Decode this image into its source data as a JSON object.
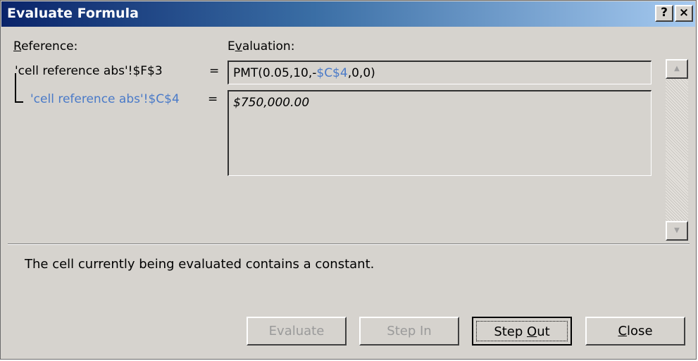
{
  "window": {
    "title": "Evaluate Formula",
    "help_label": "?",
    "close_label": "×"
  },
  "labels": {
    "reference_prefix": "R",
    "reference_rest": "eference:",
    "evaluation_prefix": "E",
    "evaluation_underline": "v",
    "evaluation_rest": "aluation:"
  },
  "references": {
    "main": "'cell reference abs'!$F$3",
    "main_eq": "=",
    "sub": "'cell reference abs'!$C$4",
    "sub_eq": "="
  },
  "evaluation": {
    "formula_before": "PMT(0.05,10,-",
    "formula_highlight": "$C$4",
    "formula_after": ",0,0)",
    "sub_value": "$750,000.00"
  },
  "scrollbar": {
    "up_icon": "▲",
    "down_icon": "▼"
  },
  "status": "The cell currently being evaluated contains a constant.",
  "buttons": {
    "evaluate": "Evaluate",
    "step_in": "Step In",
    "step_out_before": "Step ",
    "step_out_underline": "O",
    "step_out_after": "ut",
    "close_underline": "C",
    "close_after": "lose"
  },
  "colors": {
    "highlight": "#4a7ac8",
    "title_bar": "#0a246a",
    "dialog_bg": "#d6d3ce"
  }
}
